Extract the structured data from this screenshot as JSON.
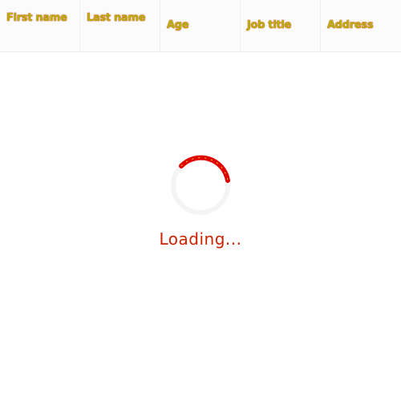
{
  "table": {
    "columns": [
      {
        "label": "First name"
      },
      {
        "label": "Last name"
      },
      {
        "label": "Age"
      },
      {
        "label": "Job title"
      },
      {
        "label": "Address"
      }
    ]
  },
  "loading": {
    "text": "Loading..."
  },
  "colors": {
    "spinner_arc": "#e00000",
    "spinner_track": "#f4f4f4",
    "header_text": "#b0b800",
    "loading_text": "#cc2200"
  }
}
